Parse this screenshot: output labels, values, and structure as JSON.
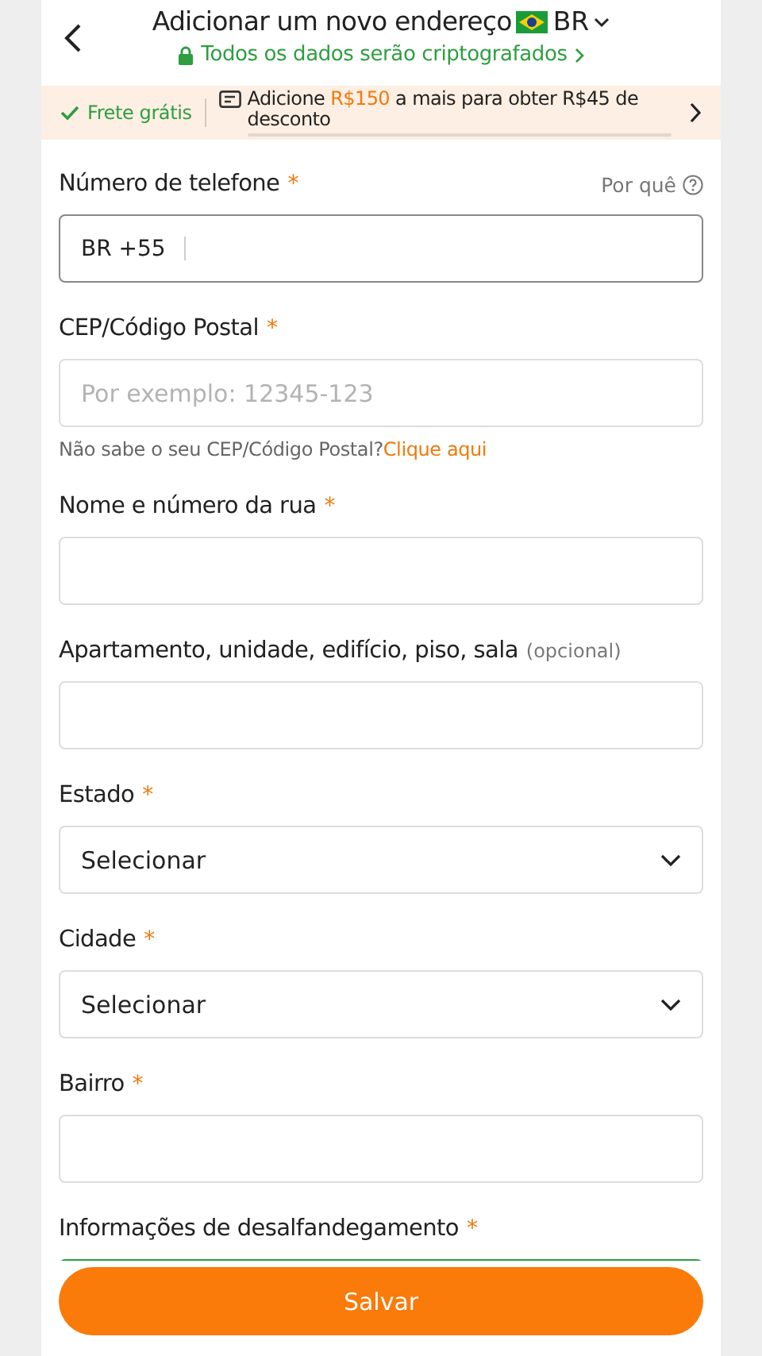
{
  "header": {
    "title": "Adicionar um novo endereço",
    "country": "BR",
    "secure_note": "Todos os dados serão criptografados"
  },
  "banner": {
    "free_shipping": "Frete grátis",
    "promo_parts": [
      "Adicione ",
      "R$150",
      " a mais para obter R$45 de desconto"
    ]
  },
  "fields": [
    {
      "kind": "phone",
      "label": "Número de telefone",
      "mark": "*",
      "aside": "Por quê",
      "prefix": "BR +55"
    },
    {
      "kind": "text",
      "label": "CEP/Código Postal",
      "mark": "*",
      "placeholder": "Por exemplo: 12345-123",
      "help": "Não sabe o seu CEP/Código Postal?",
      "help_link": "Clique aqui"
    },
    {
      "kind": "text",
      "label": "Nome e número da rua",
      "mark": "*"
    },
    {
      "kind": "text",
      "label": "Apartamento, unidade, edifício, piso, sala",
      "optional": "(opcional)"
    },
    {
      "kind": "select",
      "label": "Estado",
      "mark": "*",
      "value": "Selecionar"
    },
    {
      "kind": "select",
      "label": "Cidade",
      "mark": "*",
      "value": "Selecionar"
    },
    {
      "kind": "text",
      "label": "Bairro",
      "mark": "*"
    },
    {
      "kind": "notice",
      "label": "Informações de desalfandegamento",
      "mark": "*"
    }
  ],
  "save_button": "Salvar"
}
